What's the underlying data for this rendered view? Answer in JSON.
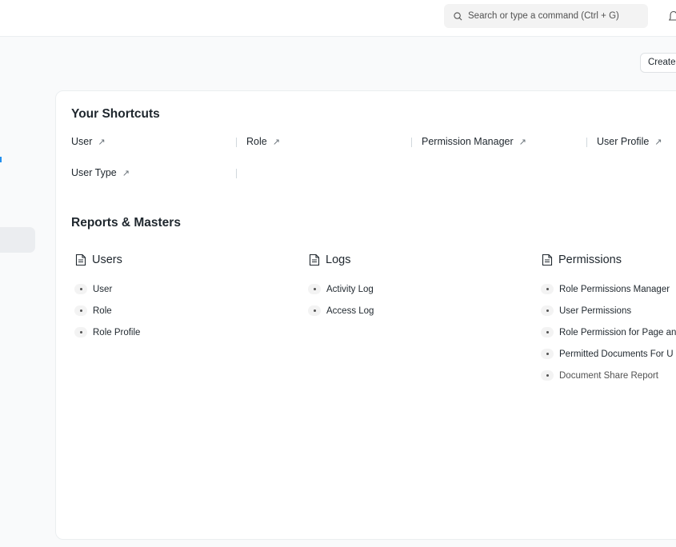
{
  "navbar": {
    "search_placeholder": "Search or type a command (Ctrl + G)"
  },
  "page": {
    "create_label": "Create"
  },
  "shortcuts": {
    "title": "Your Shortcuts",
    "items": [
      {
        "label": "User"
      },
      {
        "label": "Role"
      },
      {
        "label": "Permission Manager"
      },
      {
        "label": "User Profile"
      },
      {
        "label": "User Type"
      }
    ]
  },
  "reports": {
    "title": "Reports & Masters",
    "groups": [
      {
        "title": "Users",
        "links": [
          "User",
          "Role",
          "Role Profile"
        ]
      },
      {
        "title": "Logs",
        "links": [
          "Activity Log",
          "Access Log"
        ]
      },
      {
        "title": "Permissions",
        "links": [
          "Role Permissions Manager",
          "User Permissions",
          "Role Permission for Page an",
          "Permitted Documents For U",
          "Document Share Report"
        ]
      }
    ]
  },
  "icons": {
    "search": "search-icon",
    "bell": "bell-icon",
    "arrow": "arrow-up-right-icon",
    "doc": "document-icon"
  }
}
